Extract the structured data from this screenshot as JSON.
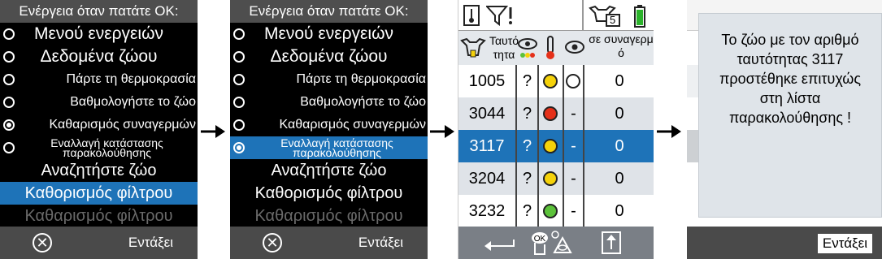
{
  "menu": {
    "title": "Ενέργεια όταν πατάτε ΟΚ:",
    "items": [
      {
        "label": "Μενού ενεργειών"
      },
      {
        "label": "Δεδομένα ζώου"
      },
      {
        "label": "Πάρτε τη θερμοκρασία"
      },
      {
        "label": "Βαθμολογήστε το ζώο"
      },
      {
        "label": "Καθαρισμός συναγερμών"
      },
      {
        "label_line1": "Εναλλαγή κατάστασης",
        "label_line2": "παρακολούθησης"
      },
      {
        "label": "Αναζητήστε ζώο"
      },
      {
        "label": "Καθορισμός φίλτρου"
      },
      {
        "label": "Καθαρισμός φίλτρου"
      }
    ],
    "footer_label": "Εντάξει",
    "cancel_icon": "cancel-circle-icon"
  },
  "list": {
    "header": {
      "id_label": "Ταυτότητα",
      "alarm_label": "σε συναγερμό"
    },
    "rows": [
      {
        "id": "1005",
        "q": "?",
        "status_color": "#f5d20a",
        "watch": "",
        "alarms": "0"
      },
      {
        "id": "3044",
        "q": "?",
        "status_color": "#e53019",
        "watch": "-",
        "alarms": "0"
      },
      {
        "id": "3117",
        "q": "?",
        "status_color": "#f5d20a",
        "watch": "-",
        "alarms": "0"
      },
      {
        "id": "3204",
        "q": "?",
        "status_color": "#f5d20a",
        "watch": "-",
        "alarms": "0"
      },
      {
        "id": "3232",
        "q": "?",
        "status_color": "#5cc23a",
        "watch": "-",
        "alarms": "0"
      }
    ],
    "herd_count": "5",
    "battery_color": "#2bb32b"
  },
  "message": {
    "text": "Το ζώο με τον αριθμό ταυτότητας 3117 προστέθηκε επιτυχώς στη λίστα παρακολούθησης !",
    "ok_label": "Εντάξει"
  },
  "colors": {
    "highlight": "#1e73b8"
  }
}
